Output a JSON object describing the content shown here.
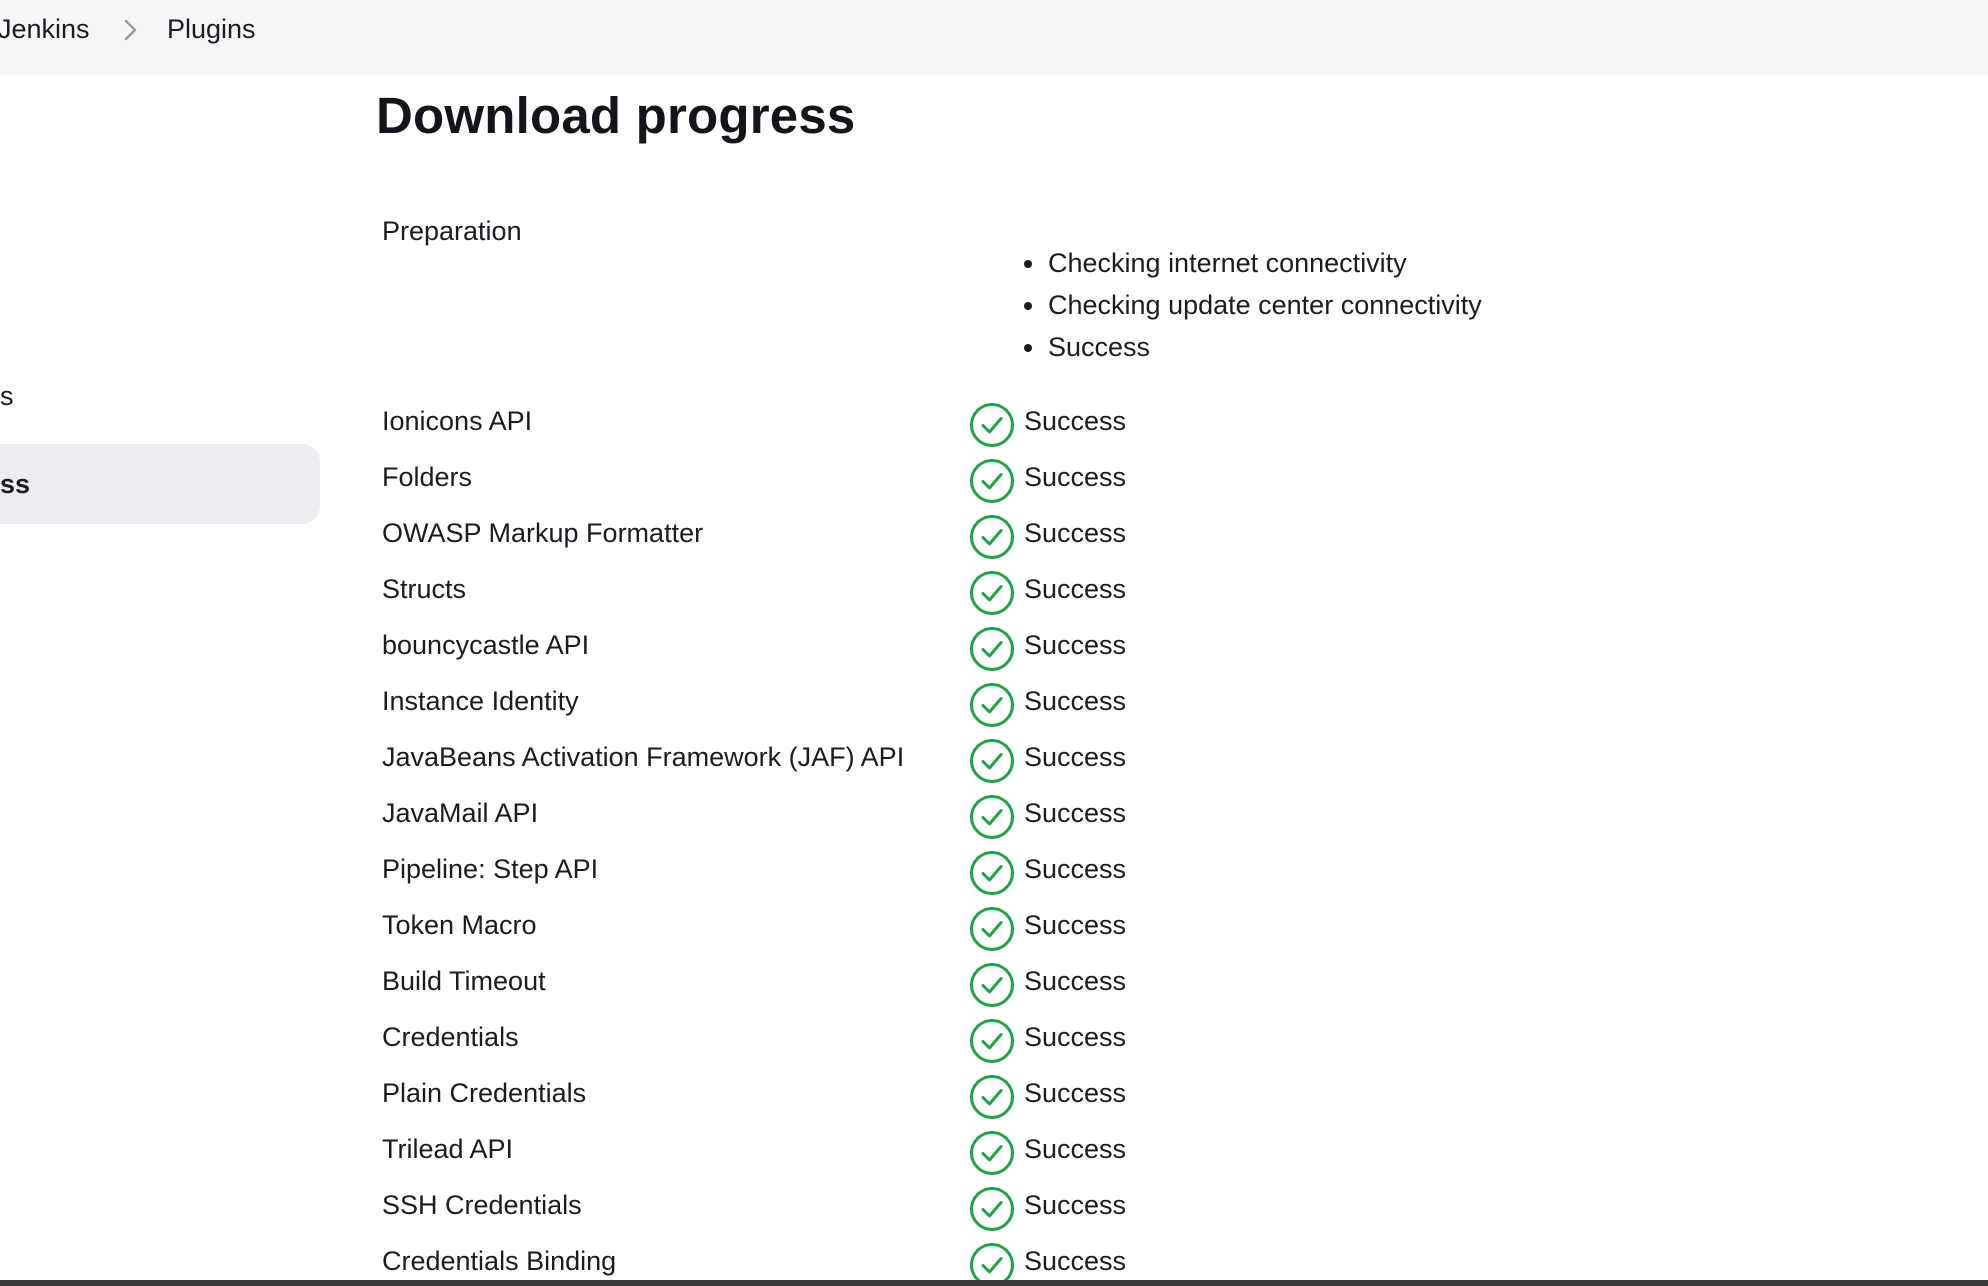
{
  "breadcrumb": {
    "items": [
      "Jenkins",
      "Plugins"
    ]
  },
  "sidebar": {
    "items": [
      {
        "label": "s"
      },
      {
        "label": "ss",
        "active": true
      }
    ]
  },
  "main": {
    "title": "Download progress",
    "preparation": {
      "label": "Preparation",
      "steps": [
        "Checking internet connectivity",
        "Checking update center connectivity",
        "Success"
      ]
    },
    "plugins": [
      {
        "name": "Ionicons API",
        "status": "Success"
      },
      {
        "name": "Folders",
        "status": "Success"
      },
      {
        "name": "OWASP Markup Formatter",
        "status": "Success"
      },
      {
        "name": "Structs",
        "status": "Success"
      },
      {
        "name": "bouncycastle API",
        "status": "Success"
      },
      {
        "name": "Instance Identity",
        "status": "Success"
      },
      {
        "name": "JavaBeans Activation Framework (JAF) API",
        "status": "Success"
      },
      {
        "name": "JavaMail API",
        "status": "Success"
      },
      {
        "name": "Pipeline: Step API",
        "status": "Success"
      },
      {
        "name": "Token Macro",
        "status": "Success"
      },
      {
        "name": "Build Timeout",
        "status": "Success"
      },
      {
        "name": "Credentials",
        "status": "Success"
      },
      {
        "name": "Plain Credentials",
        "status": "Success"
      },
      {
        "name": "Trilead API",
        "status": "Success"
      },
      {
        "name": "SSH Credentials",
        "status": "Success"
      },
      {
        "name": "Credentials Binding",
        "status": "Success"
      }
    ],
    "status_icon": "check-circle-icon",
    "success_color": "#1ea446"
  }
}
